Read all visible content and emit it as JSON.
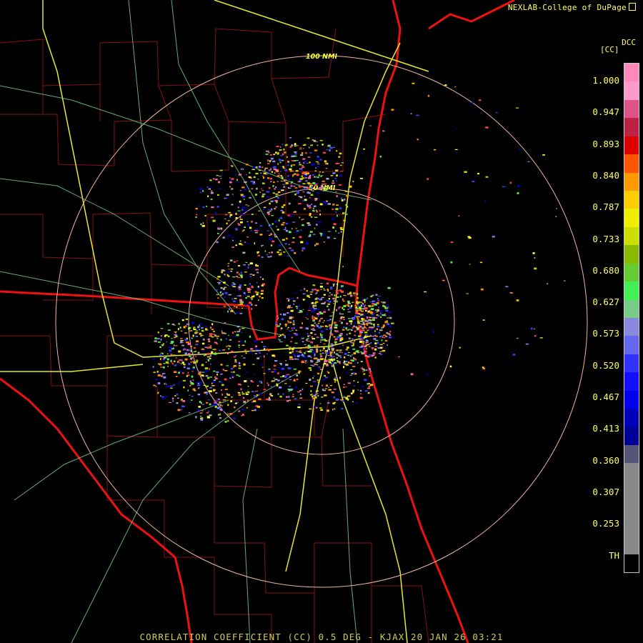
{
  "header": {
    "credit": "NEXLAB-College of DuPage",
    "product_code": "DCC",
    "unit": "[CC]"
  },
  "rings": {
    "outer_label": "100 NMI",
    "inner_label": "50 NMI"
  },
  "legend": {
    "labels": [
      "1.000",
      "0.947",
      "0.893",
      "0.840",
      "0.787",
      "0.733",
      "0.680",
      "0.627",
      "0.573",
      "0.520",
      "0.467",
      "0.413",
      "0.360",
      "0.307",
      "0.253",
      "TH"
    ],
    "bins": [
      {
        "color": "#ff88bb"
      },
      {
        "color": "#ff99cc"
      },
      {
        "color": "#dd5588"
      },
      {
        "color": "#bb2244"
      },
      {
        "color": "#dd0000"
      },
      {
        "color": "#ff5500"
      },
      {
        "color": "#ff9900"
      },
      {
        "color": "#ffcc00"
      },
      {
        "color": "#eeee00"
      },
      {
        "color": "#ccdd00"
      },
      {
        "color": "#88bb00"
      },
      {
        "color": "#66cc33"
      },
      {
        "color": "#44ee55"
      },
      {
        "color": "#77cc88"
      },
      {
        "color": "#8888dd"
      },
      {
        "color": "#6666ee"
      },
      {
        "color": "#3333ff"
      },
      {
        "color": "#1111ff"
      },
      {
        "color": "#0000ee"
      },
      {
        "color": "#0000bb"
      },
      {
        "color": "#000099"
      },
      {
        "color": "#555577"
      },
      {
        "color": "#888888"
      },
      {
        "color": "#888888"
      },
      {
        "color": "#888888"
      },
      {
        "color": "#888888"
      },
      {
        "color": "#888888"
      },
      {
        "color": "#000000"
      }
    ]
  },
  "footer": {
    "caption": "CORRELATION COEFFICIENT (CC) 0.5 DEG - KJAX 20 JAN 26 03:21"
  }
}
